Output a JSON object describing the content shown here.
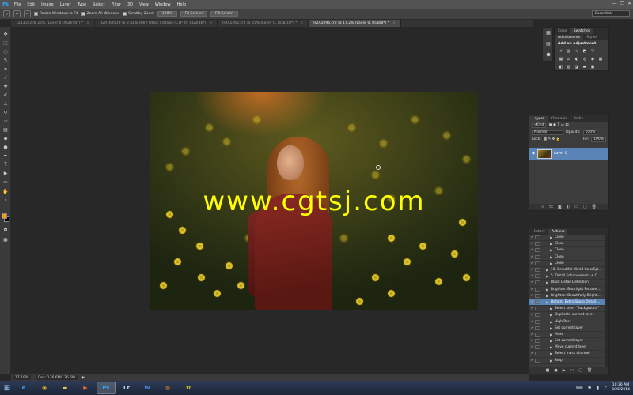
{
  "app": {
    "logo": "Ps"
  },
  "menu": [
    "File",
    "Edit",
    "Image",
    "Layer",
    "Type",
    "Select",
    "Filter",
    "3D",
    "View",
    "Window",
    "Help"
  ],
  "window_controls": [
    "—",
    "❐",
    "✕"
  ],
  "options": {
    "resize_windows_label": "Resize Windows to Fit",
    "zoom_all_label": "Zoom All Windows",
    "scrubby_zoom_label": "Scrubby Zoom",
    "btn_100": "100%",
    "btn_fit": "Fit Screen",
    "btn_fill": "Fill Screen",
    "workspace": "Essentials"
  },
  "doc_tabs": [
    {
      "label": "1213.cr2 @ 25% (Layer 0, RGB/16*) *",
      "active": false
    },
    {
      "label": "H2A1695.tif @ 9.41% (Film Otros Vintage (CTP 4), RGB/16*)",
      "active": false
    },
    {
      "label": "H2A1262.cr2 @ 25% (Layer 0, RGB/16*) *",
      "active": false
    },
    {
      "label": "H2A1096.cr2 @ 17.2% (Layer 0, RGB/8*) *",
      "active": true
    }
  ],
  "canvas": {
    "watermark": "www.cgtsj.com"
  },
  "status": {
    "zoom": "17.19%",
    "doc_size": "Doc: 136.6M/136.6M"
  },
  "color_panel": {
    "tabs": [
      "Color",
      "Swatches"
    ],
    "sub_tabs": [
      "Adjustments",
      "Styles"
    ],
    "add_adjustment": "Add an adjustment"
  },
  "layers": {
    "tabs": [
      "Layers",
      "Channels",
      "Paths"
    ],
    "kind": "Kind",
    "blend_mode": "Normal",
    "opacity_label": "Opacity:",
    "opacity_value": "100%",
    "lock_label": "Lock:",
    "fill_label": "Fill:",
    "fill_value": "100%",
    "layer_name": "Layer 0"
  },
  "actions": {
    "tabs": [
      "History",
      "Actions"
    ],
    "rows": [
      {
        "label": "Close",
        "indent": 2,
        "selected": false
      },
      {
        "label": "Close",
        "indent": 2,
        "selected": false
      },
      {
        "label": "Close",
        "indent": 2,
        "selected": false
      },
      {
        "label": "Close",
        "indent": 2,
        "selected": false
      },
      {
        "label": "Close",
        "indent": 2,
        "selected": false
      },
      {
        "label": "10. Beautiful World ColorSpl...",
        "indent": 1,
        "selected": false
      },
      {
        "label": "5. Detail Enhancement + C...",
        "indent": 1,
        "selected": false
      },
      {
        "label": "Black Detail Definition",
        "indent": 1,
        "selected": false
      },
      {
        "label": "Brighten: Backlight Recover...",
        "indent": 1,
        "selected": false
      },
      {
        "label": "Brighten: Beautifully Bright...",
        "indent": 1,
        "selected": false
      },
      {
        "label": "Details: Extra Sharp Detail ...",
        "indent": 1,
        "selected": true
      },
      {
        "label": "Select layer \"Background\"",
        "indent": 2,
        "selected": false
      },
      {
        "label": "Duplicate current layer",
        "indent": 2,
        "selected": false
      },
      {
        "label": "High Pass",
        "indent": 2,
        "selected": false
      },
      {
        "label": "Set current layer",
        "indent": 2,
        "selected": false
      },
      {
        "label": "Make",
        "indent": 2,
        "selected": false
      },
      {
        "label": "Set current layer",
        "indent": 2,
        "selected": false
      },
      {
        "label": "Move current layer",
        "indent": 2,
        "selected": false
      },
      {
        "label": "Select mask channel",
        "indent": 2,
        "selected": false
      },
      {
        "label": "Stop",
        "indent": 2,
        "selected": false
      }
    ]
  },
  "taskbar": {
    "apps": [
      {
        "name": "ie",
        "glyph": "e",
        "color": "#3ba0e6",
        "active": false
      },
      {
        "name": "chrome",
        "glyph": "◉",
        "color": "#e8b22c",
        "active": false
      },
      {
        "name": "explorer",
        "glyph": "▬",
        "color": "#e8c25a",
        "active": false
      },
      {
        "name": "media",
        "glyph": "▶",
        "color": "#e86a2a",
        "active": false
      },
      {
        "name": "photoshop",
        "glyph": "Ps",
        "color": "#31a8ff",
        "active": true
      },
      {
        "name": "lightroom",
        "glyph": "Lr",
        "color": "#b4d3f0",
        "active": false
      },
      {
        "name": "word",
        "glyph": "W",
        "color": "#4a86d8",
        "active": false
      },
      {
        "name": "firefox",
        "glyph": "◍",
        "color": "#e88a2a",
        "active": false
      },
      {
        "name": "misc",
        "glyph": "✿",
        "color": "#e8c22a",
        "active": false
      }
    ],
    "time": "10:36 AM",
    "date": "8/26/2014"
  }
}
